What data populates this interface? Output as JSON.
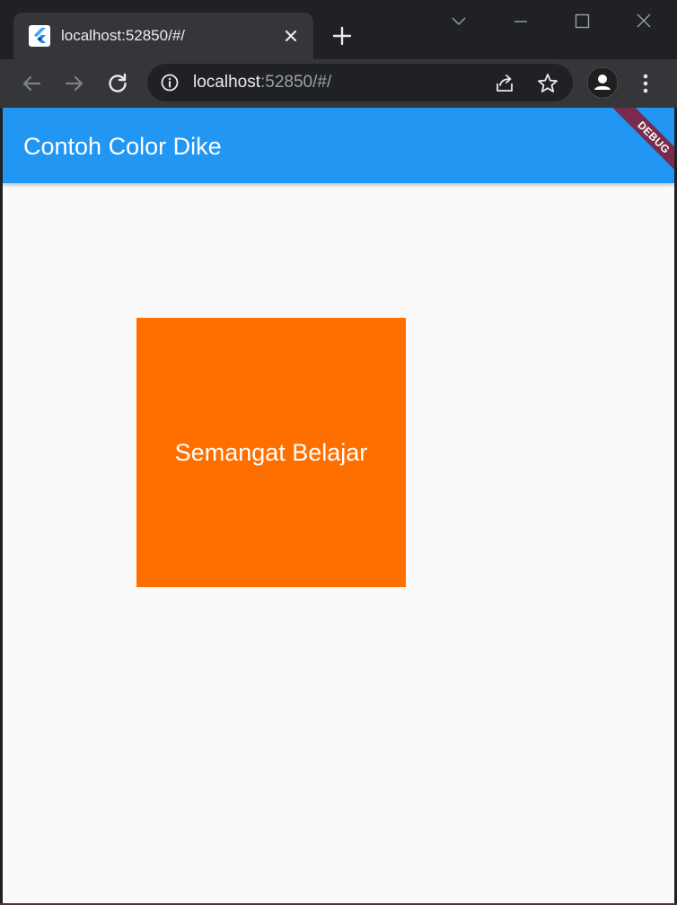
{
  "browser": {
    "tab": {
      "title": "localhost:52850/#/",
      "favicon": "flutter-icon"
    },
    "address_bar": {
      "host": "localhost",
      "rest": ":52850/#/"
    },
    "icons": {
      "back": "arrow-left-icon",
      "forward": "arrow-right-icon",
      "reload": "reload-icon",
      "info": "info-icon",
      "share": "share-icon",
      "bookmark": "star-icon",
      "profile": "person-icon",
      "menu": "kebab-menu-icon",
      "tab_search": "chevron-down-icon",
      "minimize": "minimize-icon",
      "maximize": "maximize-icon",
      "close_window": "close-icon"
    }
  },
  "app": {
    "title": "Contoh Color Dike",
    "debug_banner": "DEBUG",
    "box_text": "Semangat Belajar"
  },
  "colors": {
    "appbar": "#2196f3",
    "box": "#ff6f00",
    "background": "#fafafa",
    "debug_banner": "#7a2a4a"
  }
}
